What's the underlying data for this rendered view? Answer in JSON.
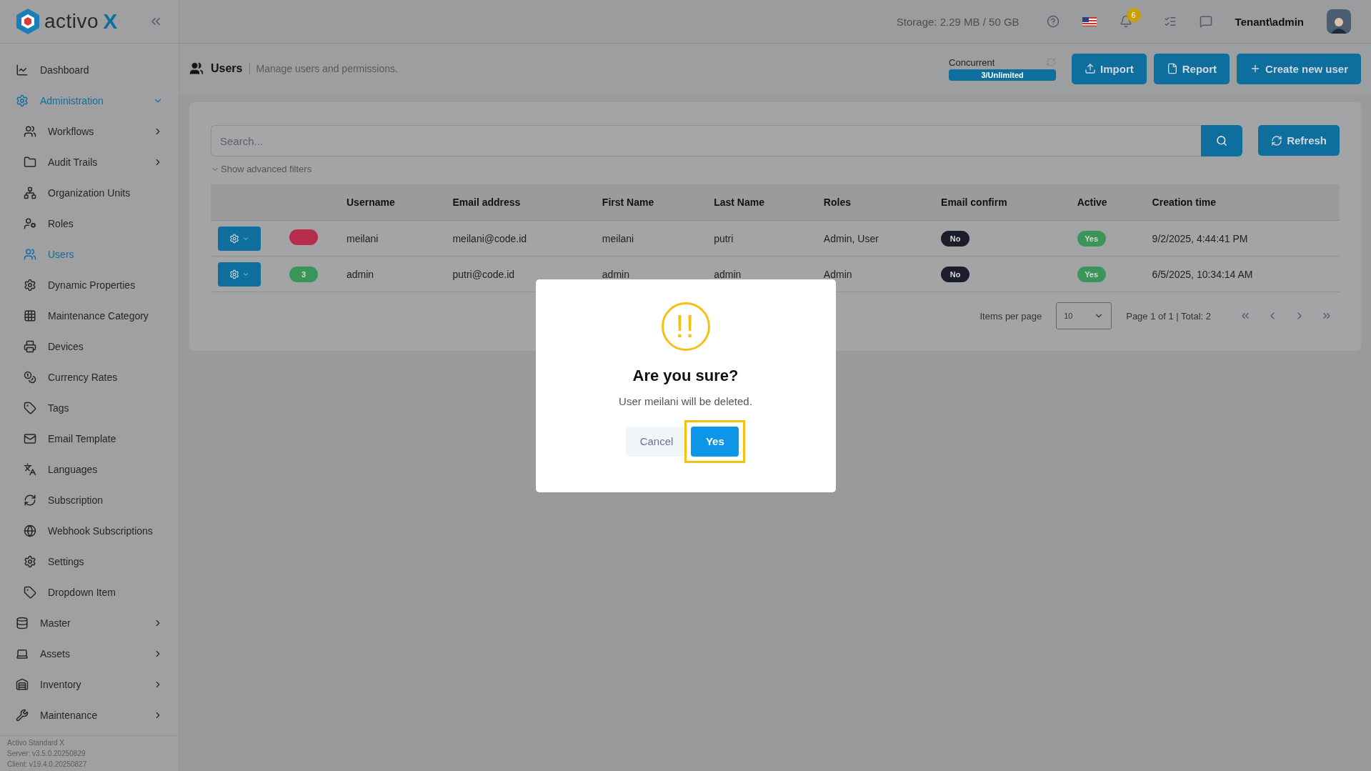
{
  "brand": {
    "name": "activo",
    "mark": "X"
  },
  "sidebar": {
    "items": [
      {
        "label": "Dashboard",
        "selected": false
      },
      {
        "label": "Administration",
        "selected": true,
        "expanded": true,
        "children": [
          {
            "label": "Workflows",
            "selected": false,
            "expanded": false
          },
          {
            "label": "Audit Trails",
            "selected": false,
            "expanded": false
          },
          {
            "label": "Organization Units",
            "selected": false
          },
          {
            "label": "Roles",
            "selected": false
          },
          {
            "label": "Users",
            "selected": true
          },
          {
            "label": "Dynamic Properties",
            "selected": false
          },
          {
            "label": "Maintenance Category",
            "selected": false
          },
          {
            "label": "Devices",
            "selected": false
          },
          {
            "label": "Currency Rates",
            "selected": false
          },
          {
            "label": "Tags",
            "selected": false
          },
          {
            "label": "Email Template",
            "selected": false
          },
          {
            "label": "Languages",
            "selected": false
          },
          {
            "label": "Subscription",
            "selected": false
          },
          {
            "label": "Webhook Subscriptions",
            "selected": false
          },
          {
            "label": "Settings",
            "selected": false
          },
          {
            "label": "Dropdown Item",
            "selected": false
          }
        ]
      },
      {
        "label": "Master",
        "selected": false,
        "expanded": false
      },
      {
        "label": "Assets",
        "selected": false,
        "expanded": false
      },
      {
        "label": "Inventory",
        "selected": false,
        "expanded": false
      },
      {
        "label": "Maintenance",
        "selected": false,
        "expanded": false
      }
    ],
    "footer": [
      "Activo Standard X",
      "Server: v3.5.0.20250829",
      "Client: v19.4.0.20250827"
    ]
  },
  "topbar": {
    "storage": "Storage: 2.29 MB / 50 GB",
    "notification_count": "6",
    "user": "Tenant\\admin"
  },
  "page": {
    "title": "Users",
    "subtitle": "Manage users and permissions.",
    "concurrent": {
      "label": "Concurrent",
      "value": "3/Unlimited"
    },
    "buttons": [
      "Import",
      "Report",
      "Create new user"
    ]
  },
  "search": {
    "placeholder": "Search...",
    "refresh": "Refresh",
    "advanced": "Show advanced filters"
  },
  "table": {
    "columns": [
      "Username",
      "Email address",
      "First Name",
      "Last Name",
      "Roles",
      "Email confirm",
      "Active",
      "Creation time"
    ],
    "rows": [
      {
        "badge": {
          "color": "#b52d4b"
        },
        "cells": [
          "meilani",
          "meilani@code.id",
          "meilani",
          "putri",
          "Admin, User",
          "No",
          "Yes",
          "9/2/2025, 4:44:41 PM"
        ]
      },
      {
        "badge": {
          "text": "3",
          "color": "#3a9559"
        },
        "cells": [
          "admin",
          "putri@code.id",
          "admin",
          "admin",
          "Admin",
          "No",
          "Yes",
          "6/5/2025, 10:34:14 AM"
        ]
      }
    ]
  },
  "pagination": {
    "label": "Items per page",
    "page_size": "10",
    "summary": "Page 1 of 1 | Total: 2"
  },
  "dialog": {
    "icon": "!!",
    "title": "Are you sure?",
    "message": "User meilani will be deleted.",
    "cancel": "Cancel",
    "confirm": "Yes",
    "confirm_highlighted": true
  }
}
